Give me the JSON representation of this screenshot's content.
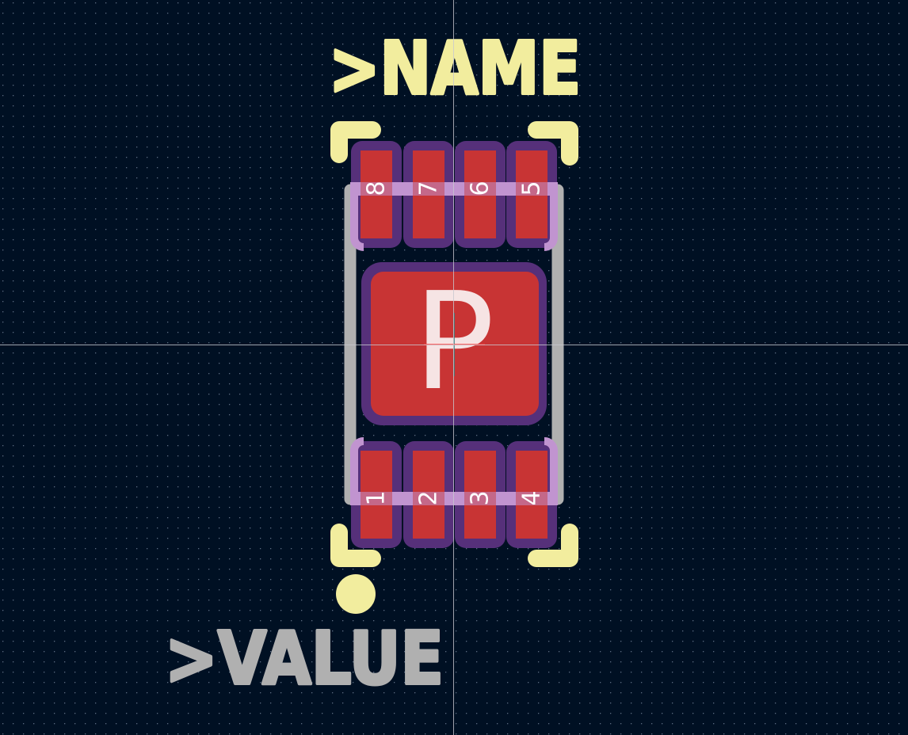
{
  "canvas": {
    "background": "#001023",
    "grid_color": "#7a8aa0",
    "crosshair_color": "#c8c8d0"
  },
  "footprint": {
    "name_text": ">NAME",
    "value_text": ">VALUE",
    "center_pad_label": "P",
    "top_pads": [
      "8",
      "7",
      "6",
      "5"
    ],
    "bottom_pads": [
      "1",
      "2",
      "3",
      "4"
    ],
    "colors": {
      "pad": "#c83434",
      "mask": "#56307a",
      "courtyard": "#c194d0",
      "fab": "#b0b0b0",
      "silkscreen": "#f2ed9e",
      "pad_text": "#ffffff"
    }
  }
}
